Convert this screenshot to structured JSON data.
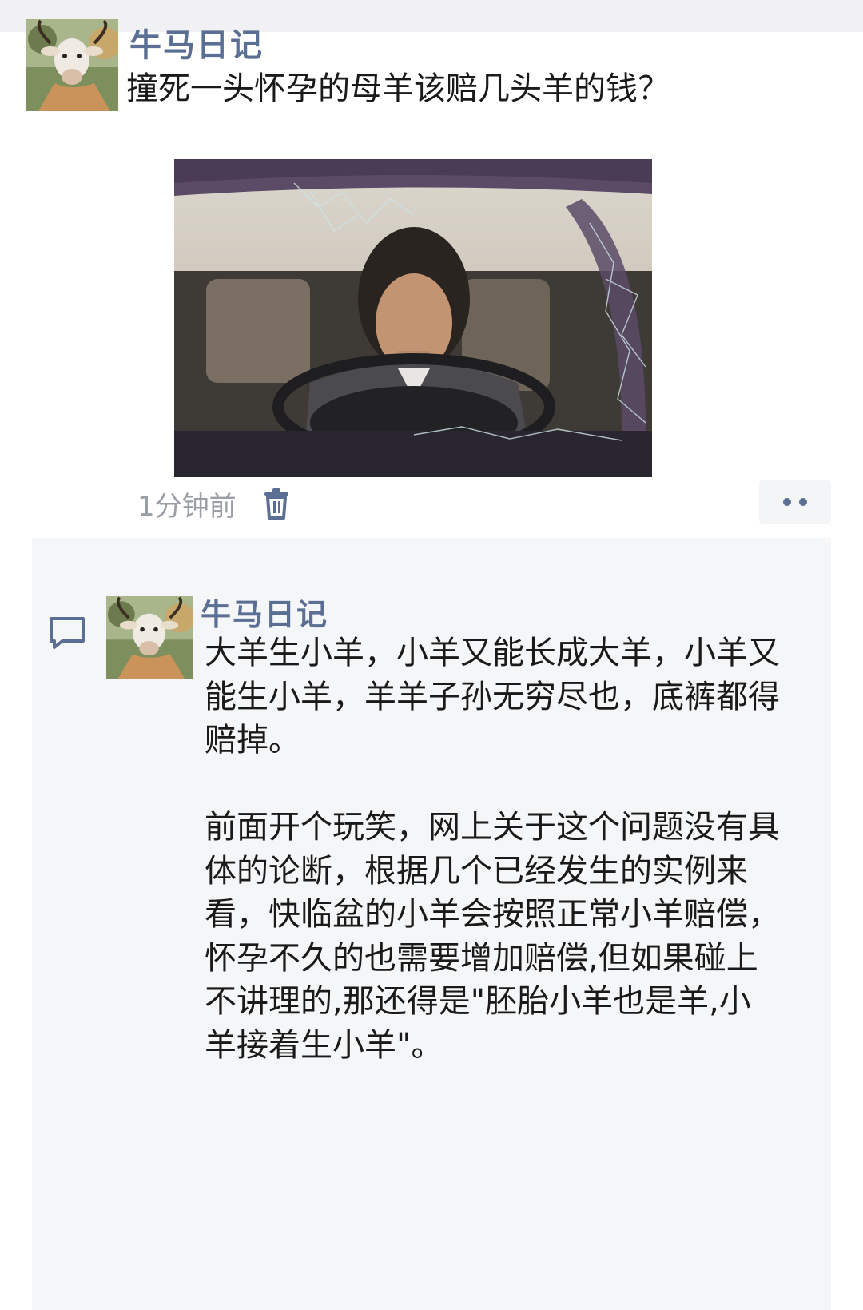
{
  "post": {
    "author": "牛马日记",
    "avatar_icon": "cow-avatar-icon",
    "text": "撞死一头怀孕的母羊该赔几头羊的钱？",
    "time": "1分钟前",
    "delete_icon": "trash-icon",
    "more_icon": "more-dots-icon"
  },
  "comment": {
    "icon": "comment-bubble-icon",
    "author": "牛马日记",
    "paragraphs": [
      "大羊生小羊，小羊又能长成大羊，小羊又能生小羊，羊羊子孙无穷尽也，底裤都得赔掉。",
      "前面开个玩笑，网上关于这个问题没有具体的论断，根据几个已经发生的实例来看，快临盆的小羊会按照正常小羊赔偿，怀孕不久的也需要增加赔偿,但如果碰上不讲理的,那还得是\"胚胎小羊也是羊,小羊接着生小羊\"。"
    ]
  },
  "colors": {
    "author_link": "#5a6f93",
    "muted_text": "#9a9ea6",
    "comment_bg": "#f5f6f7"
  }
}
